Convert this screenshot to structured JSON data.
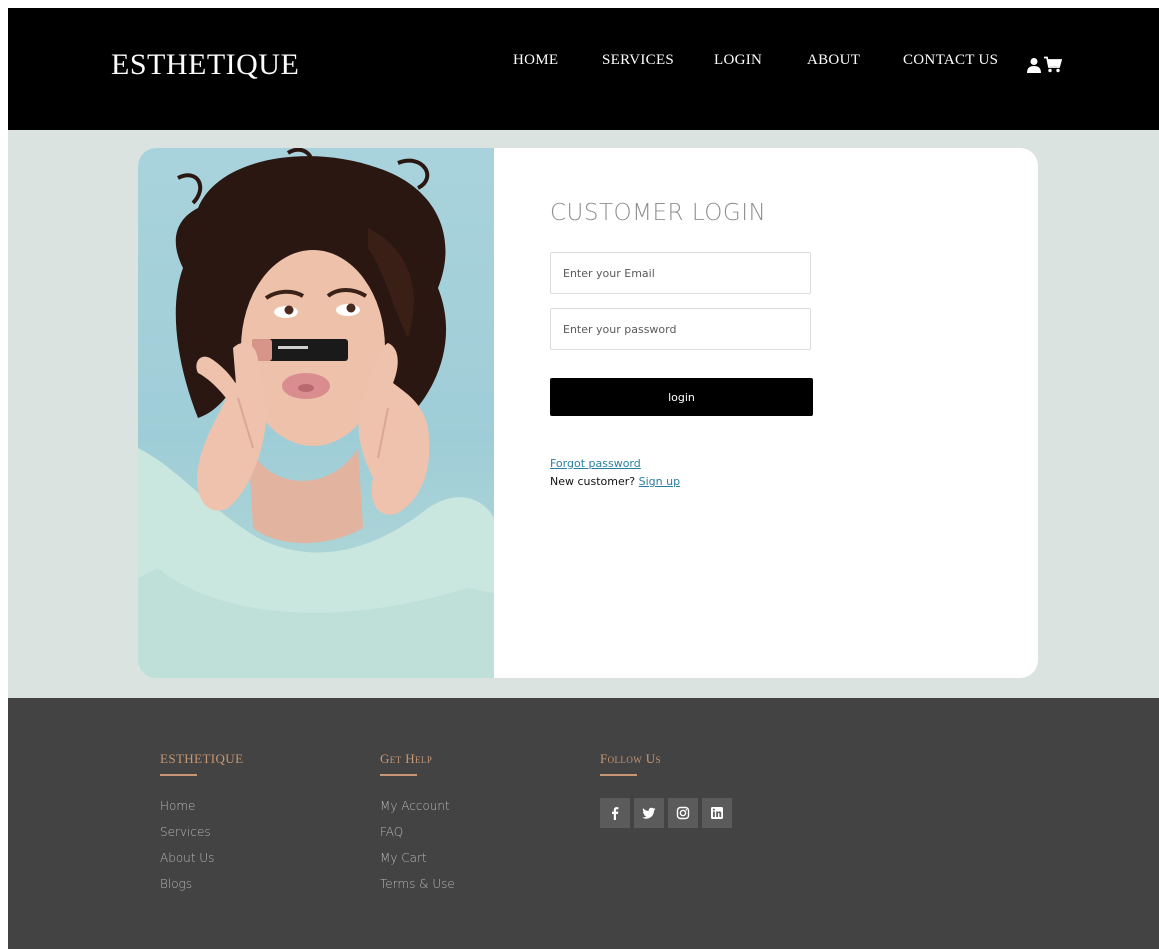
{
  "header": {
    "brand": "ESTHETIQUE",
    "nav": [
      "HOME",
      "SERVICES",
      "LOGIN",
      "ABOUT",
      "CONTACT US"
    ],
    "icons": [
      "user-icon",
      "cart-icon"
    ]
  },
  "login": {
    "title": "CUSTOMER LOGIN",
    "email_placeholder": "Enter your Email",
    "password_placeholder": "Enter your password",
    "button_label": "login",
    "forgot_label": "Forgot password",
    "new_customer_text": "New customer? ",
    "signup_label": "Sign up"
  },
  "footer": {
    "columns": [
      {
        "heading": "ESTHETIQUE",
        "links": [
          "Home",
          "Services",
          "About Us",
          "Blogs"
        ]
      },
      {
        "heading": "Get Help",
        "links": [
          "My Account",
          "FAQ",
          "My Cart",
          "Terms & Use"
        ]
      },
      {
        "heading": "Follow Us",
        "socials": [
          "facebook-icon",
          "twitter-icon",
          "instagram-icon",
          "linkedin-icon"
        ]
      }
    ]
  },
  "colors": {
    "header_bg": "#000000",
    "page_bg": "#dbe3e1",
    "footer_bg": "#434343",
    "footer_accent": "#c79773",
    "link": "#2a7fa0",
    "button_bg": "#000000"
  }
}
